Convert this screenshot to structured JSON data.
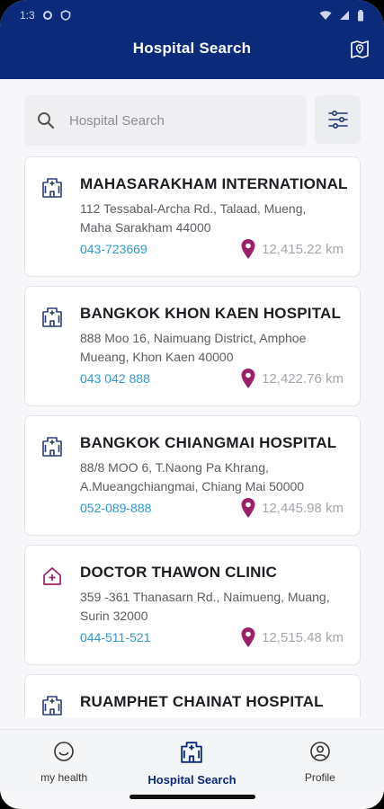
{
  "status": {
    "time": "1:3"
  },
  "header": {
    "title": "Hospital Search"
  },
  "search": {
    "placeholder": "Hospital Search"
  },
  "hospitals": [
    {
      "name": "MAHASARAKHAM INTERNATIONAL",
      "address": "112 Tessabal-Archa Rd., Talaad, Mueng, Maha Sarakham 44000",
      "phone": "043-723669",
      "distance": "12,415.22 km",
      "type": "hospital"
    },
    {
      "name": "BANGKOK KHON KAEN HOSPITAL",
      "address": "888 Moo 16, Naimuang District, Amphoe Mueang, Khon Kaen 40000",
      "phone": "043 042 888",
      "distance": "12,422.76 km",
      "type": "hospital"
    },
    {
      "name": "BANGKOK CHIANGMAI HOSPITAL",
      "address": "88/8 MOO 6, T.Naong Pa Khrang, A.Mueangchiangmai, Chiang Mai 50000",
      "phone": "052-089-888",
      "distance": "12,445.98 km",
      "type": "hospital"
    },
    {
      "name": "DOCTOR THAWON CLINIC",
      "address": "359 -361 Thanasarn Rd., Naimueng, Muang, Surin 32000",
      "phone": "044-511-521",
      "distance": "12,515.48 km",
      "type": "clinic"
    },
    {
      "name": "RUAMPHET CHAINAT HOSPITAL",
      "address": "",
      "phone": "",
      "distance": "",
      "type": "hospital"
    }
  ],
  "nav": [
    {
      "label": "my health",
      "icon": "smile-face-icon",
      "active": false
    },
    {
      "label": "Hospital Search",
      "icon": "hospital-building-icon",
      "active": true
    },
    {
      "label": "Profile",
      "icon": "profile-icon",
      "active": false
    }
  ],
  "colors": {
    "header": "#0b2a7a",
    "pin": "#9c1f6a",
    "phone_link": "#2e9bd0"
  }
}
